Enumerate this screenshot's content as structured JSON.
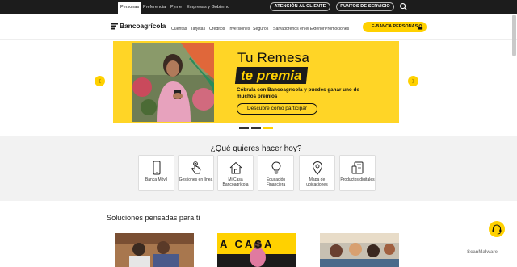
{
  "topbar": {
    "segments": [
      "Personas",
      "Preferencial",
      "Pyme",
      "Empresas y Gobierno"
    ],
    "buttons": [
      "ATENCIÓN AL CLIENTE",
      "PUNTOS DE SERVICIO"
    ]
  },
  "header": {
    "logo": "Bancoagrícola",
    "nav": [
      "Cuentas",
      "Tarjetas",
      "Créditos",
      "Inversiones",
      "Seguros",
      "Salvadoreños en el Exterior",
      "Promociones"
    ],
    "ebanca": "E-BANCA PERSONAS"
  },
  "hero": {
    "title": "Tu Remesa",
    "highlight": "te premia",
    "description": "Cóbrala con Bancoagrícola y puedes ganar uno de muchos premios",
    "cta": "Descubre cómo participar",
    "slides_total": 3,
    "slide_active": 3
  },
  "quick": {
    "title": "¿Qué quieres hacer hoy?",
    "items": [
      {
        "label": "Banca Móvil",
        "icon": "phone-icon"
      },
      {
        "label": "Gestiones en línea",
        "icon": "tap-hand-icon"
      },
      {
        "label": "Mi Casa Bancoagrícola",
        "icon": "house-icon"
      },
      {
        "label": "Educación Financiera",
        "icon": "lightbulb-icon"
      },
      {
        "label": "Mapa de ubicaciones",
        "icon": "location-pin-icon"
      },
      {
        "label": "Productos digitales",
        "icon": "devices-icon"
      }
    ]
  },
  "solutions": {
    "title": "Soluciones pensadas para ti",
    "promo_text": "A CASA"
  },
  "watermark": "ScanMalware",
  "colors": {
    "brand_yellow": "#ffd100",
    "dark": "#1c1c1c"
  }
}
